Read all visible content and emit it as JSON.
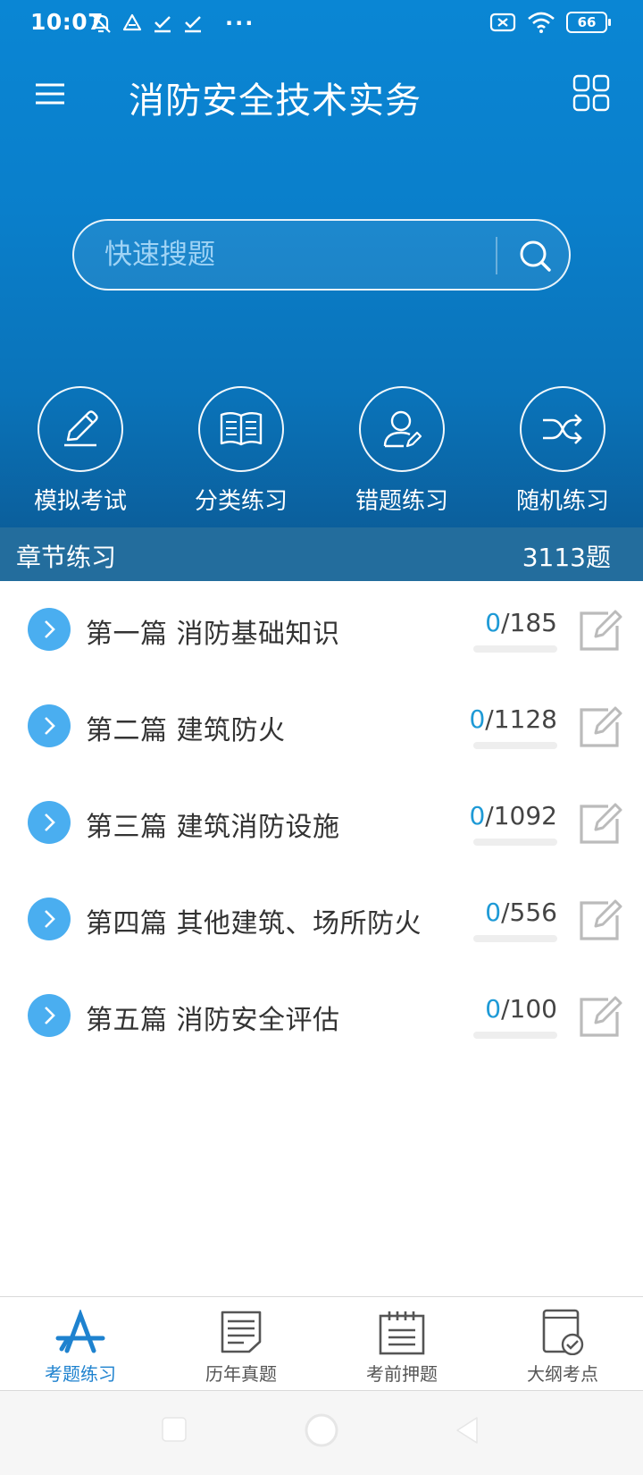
{
  "status_bar": {
    "time": "10:07",
    "dots": "···",
    "battery": "66"
  },
  "app_bar": {
    "title": "消防安全技术实务"
  },
  "search": {
    "placeholder": "快速搜题"
  },
  "quick_actions": [
    {
      "label": "模拟考试",
      "icon": "pencil-icon"
    },
    {
      "label": "分类练习",
      "icon": "open-book-icon"
    },
    {
      "label": "错题练习",
      "icon": "user-edit-icon"
    },
    {
      "label": "随机练习",
      "icon": "shuffle-icon"
    }
  ],
  "section": {
    "title": "章节练习",
    "count": "3113题"
  },
  "chapters": [
    {
      "title": "第一篇 消防基础知识",
      "done": "0",
      "total": "/185",
      "progress": 0
    },
    {
      "title": "第二篇 建筑防火",
      "done": "0",
      "total": "/1128",
      "progress": 0
    },
    {
      "title": "第三篇 建筑消防设施",
      "done": "0",
      "total": "/1092",
      "progress": 0
    },
    {
      "title": "第四篇 其他建筑、场所防火",
      "done": "0",
      "total": "/556",
      "progress": 0
    },
    {
      "title": "第五篇 消防安全评估",
      "done": "0",
      "total": "/100",
      "progress": 0
    }
  ],
  "tabs": [
    {
      "label": "考题练习",
      "active": true
    },
    {
      "label": "历年真题",
      "active": false
    },
    {
      "label": "考前押题",
      "active": false
    },
    {
      "label": "大纲考点",
      "active": false
    }
  ],
  "colors": {
    "accent": "#1e82cf",
    "progress_done": "#1e9ad6",
    "section_bar": "#236d9d",
    "chapter_arrow": "#4aaef0"
  }
}
